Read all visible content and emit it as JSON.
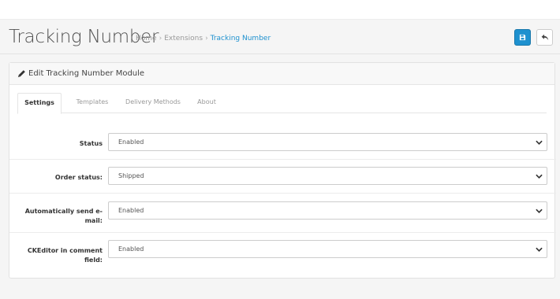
{
  "header": {
    "title": "Tracking Number",
    "breadcrumb": [
      {
        "label": "Home"
      },
      {
        "label": "Extensions"
      },
      {
        "label": "Tracking Number"
      }
    ],
    "separator": "›"
  },
  "toolbar": {
    "save_icon": "save-icon",
    "back_icon": "reply-icon",
    "save_color": "#1e91cf"
  },
  "panel": {
    "icon": "pencil-icon",
    "title": "Edit Tracking Number Module"
  },
  "tabs": [
    {
      "label": "Settings",
      "active": true
    },
    {
      "label": "Templates",
      "active": false
    },
    {
      "label": "Delivery Methods",
      "active": false
    },
    {
      "label": "About",
      "active": false
    }
  ],
  "form": {
    "fields": [
      {
        "label": "Status",
        "value": "Enabled"
      },
      {
        "label": "Order status:",
        "value": "Shipped"
      },
      {
        "label_line1": "Automatically send e-",
        "label_line2": "mail:",
        "value": "Enabled"
      },
      {
        "label_line1": "CKEditor in comment",
        "label_line2": "field:",
        "value": "Enabled"
      }
    ]
  },
  "colors": {
    "accent": "#1e91cf",
    "link": "#1e91cf",
    "background": "#f5f5f5"
  }
}
